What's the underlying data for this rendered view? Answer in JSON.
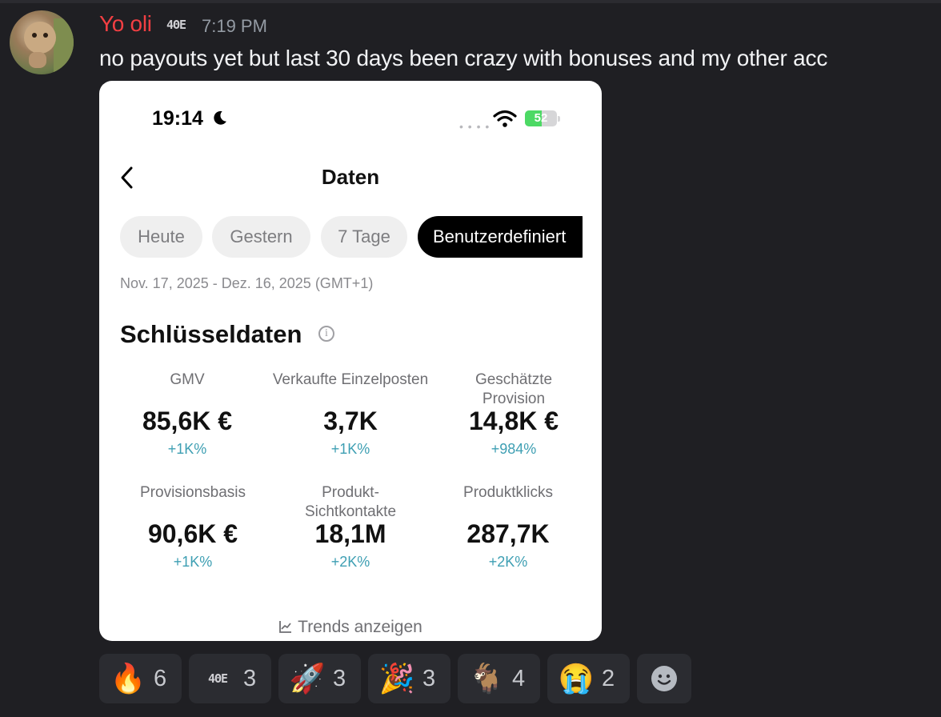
{
  "message": {
    "username": "Yo oli",
    "tag_text": "4ΘE",
    "timestamp": "7:19 PM",
    "text": "no payouts yet but last 30 days been crazy with bonuses and my other acc"
  },
  "screenshot": {
    "status_bar": {
      "time": "19:14",
      "battery": "52"
    },
    "page_title": "Daten",
    "tabs": [
      {
        "label": "Heute",
        "active": false
      },
      {
        "label": "Gestern",
        "active": false
      },
      {
        "label": "7 Tage",
        "active": false
      },
      {
        "label": "Benutzerdefiniert",
        "active": true
      }
    ],
    "date_range": "Nov. 17, 2025 - Dez. 16, 2025 (GMT+1)",
    "section_title": "Schlüsseldaten",
    "metrics": [
      {
        "label": "GMV",
        "value": "85,6K €",
        "delta": "+1K%"
      },
      {
        "label": "Verkaufte Einzelposten",
        "value": "3,7K",
        "delta": "+1K%"
      },
      {
        "label": "Geschätzte Provision",
        "value": "14,8K €",
        "delta": "+984%"
      },
      {
        "label": "Provisionsbasis",
        "value": "90,6K €",
        "delta": "+1K%"
      },
      {
        "label": "Produkt-Sichtkontakte",
        "value": "18,1M",
        "delta": "+2K%"
      },
      {
        "label": "Produktklicks",
        "value": "287,7K",
        "delta": "+2K%"
      }
    ],
    "trends_link": "Trends anzeigen",
    "delta_color": "#3e9fb3"
  },
  "reactions": [
    {
      "icon": "fire-emoji",
      "emoji": "🔥",
      "count": "6"
    },
    {
      "icon": "server-tag-emoji",
      "emoji": "4ΘE",
      "count": "3"
    },
    {
      "icon": "rocket-emoji",
      "emoji": "🚀",
      "count": "3"
    },
    {
      "icon": "party-popper-emoji",
      "emoji": "🎉",
      "count": "3"
    },
    {
      "icon": "goat-emoji",
      "emoji": "🐐",
      "count": "4"
    },
    {
      "icon": "loudly-crying-emoji",
      "emoji": "😭",
      "count": "2"
    }
  ],
  "colors": {
    "username": "#f23f43",
    "background": "#1f1f23",
    "reaction_bg": "#2b2c31"
  }
}
